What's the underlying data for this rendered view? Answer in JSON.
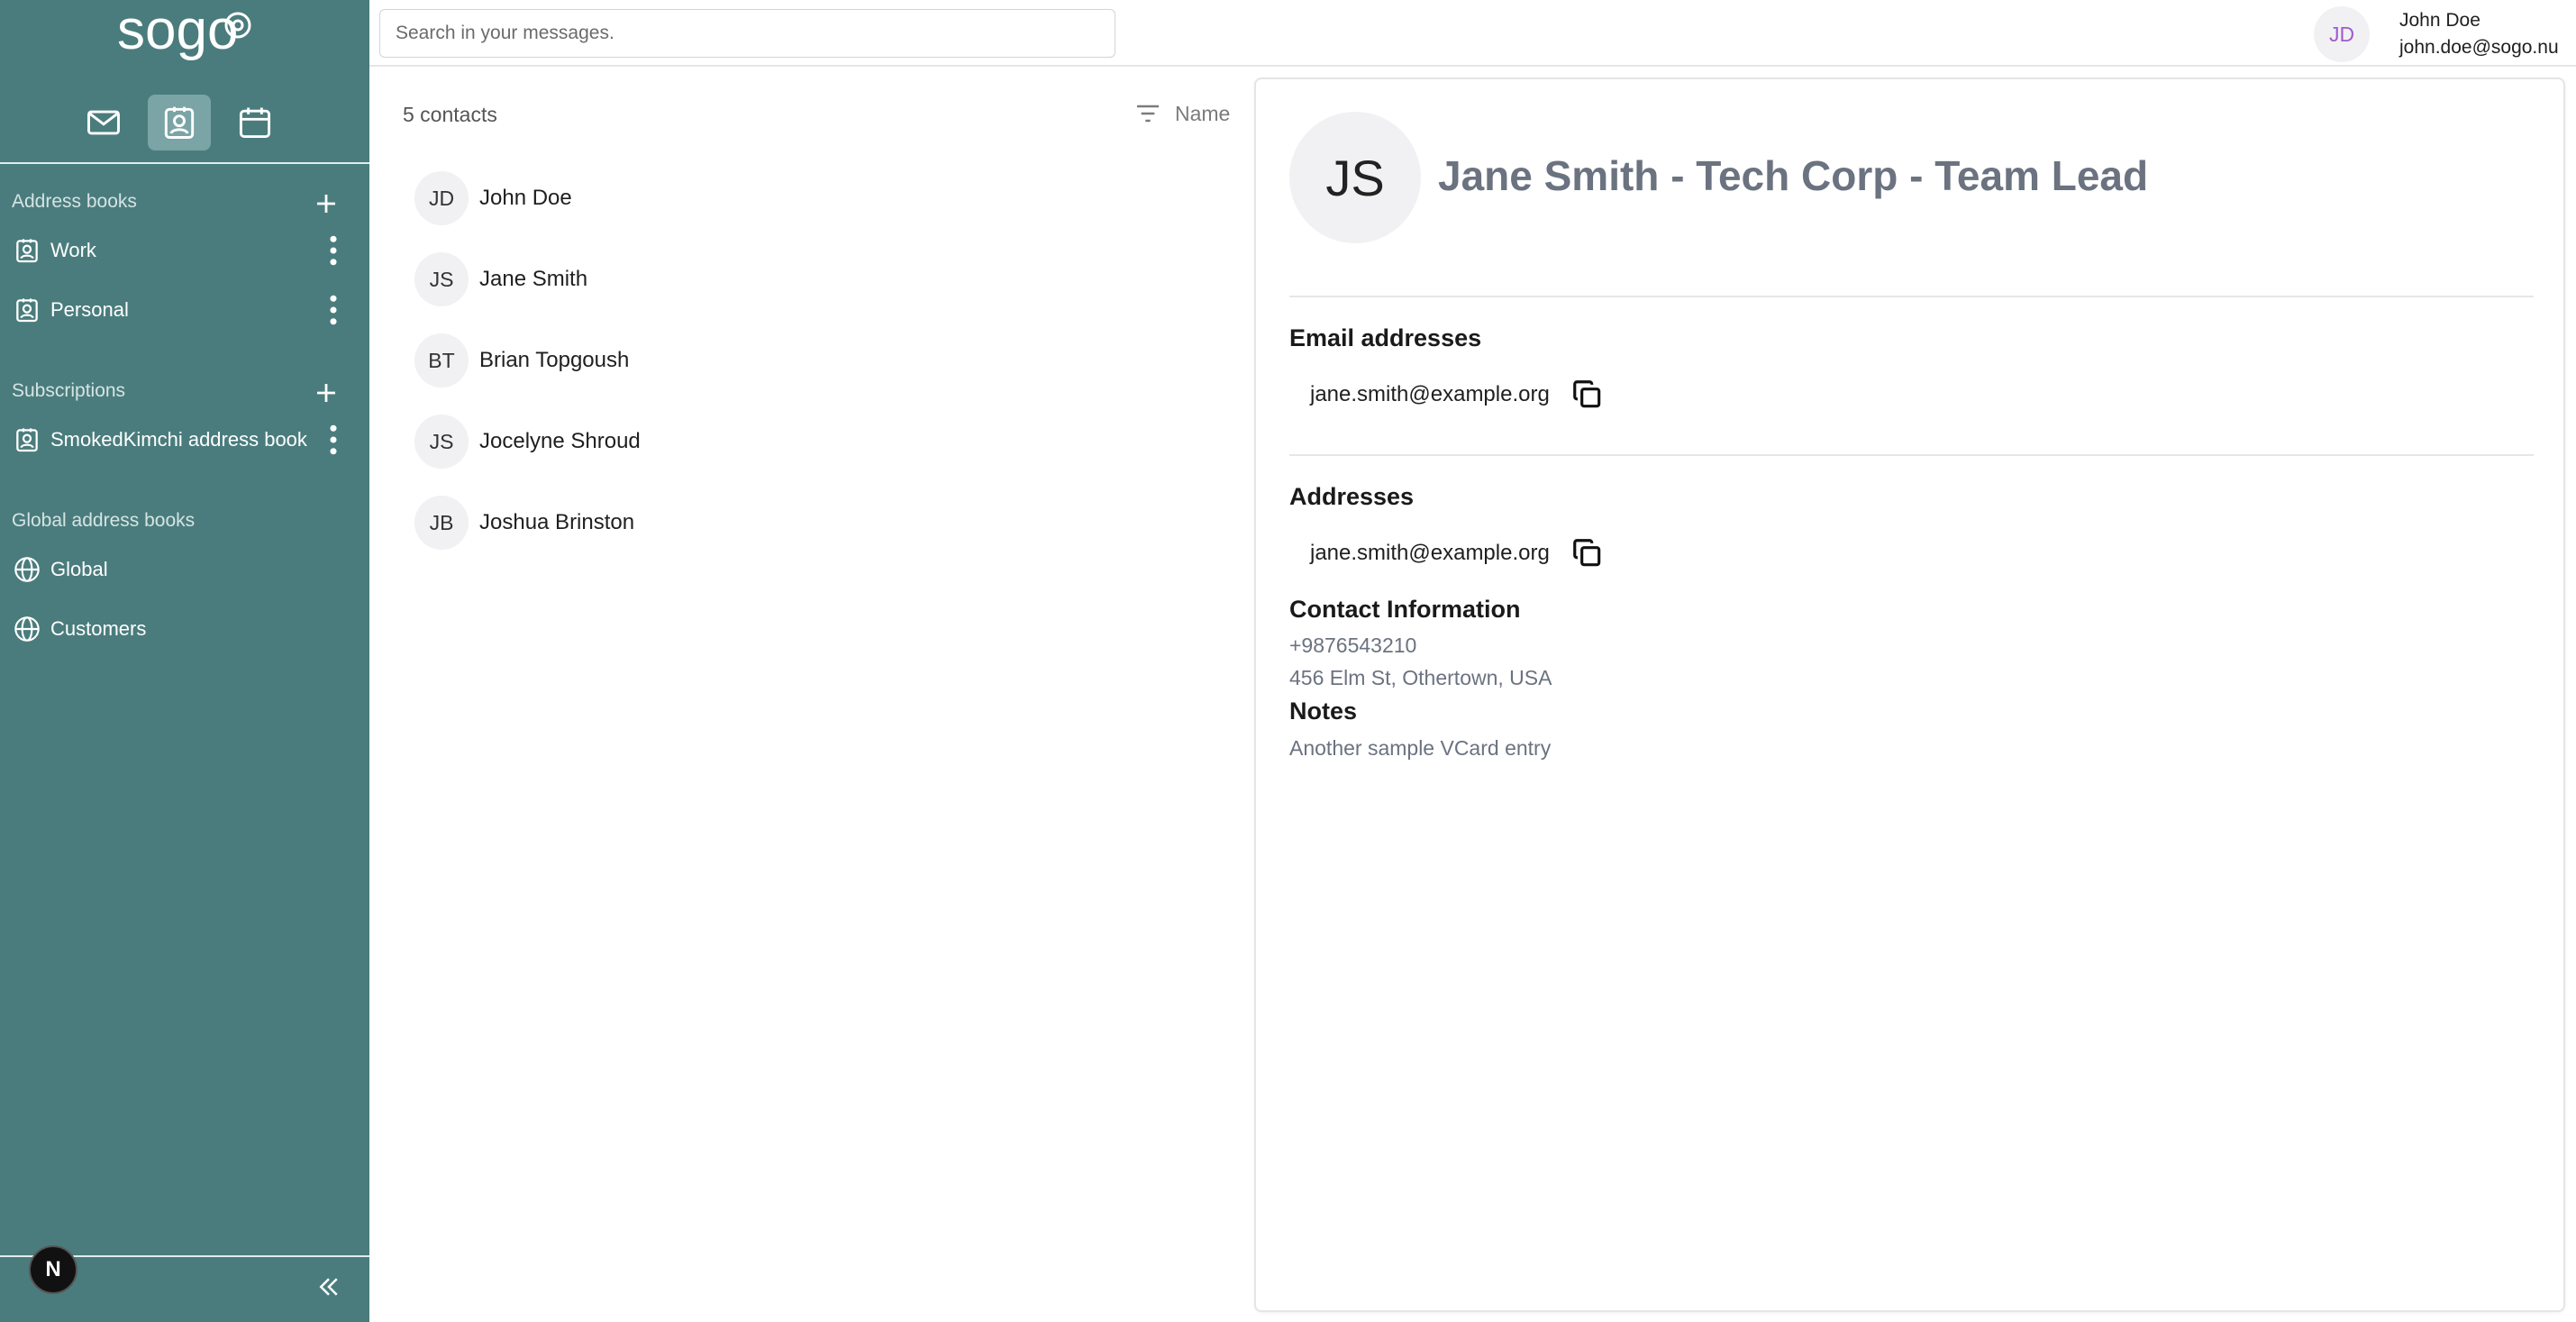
{
  "app": {
    "logo_text": "sogo"
  },
  "sidebar": {
    "address_books_title": "Address books",
    "address_books": [
      {
        "label": "Work"
      },
      {
        "label": "Personal"
      }
    ],
    "subscriptions_title": "Subscriptions",
    "subscriptions": [
      {
        "label": "SmokedKimchi address book"
      }
    ],
    "global_title": "Global address books",
    "global_books": [
      {
        "label": "Global"
      },
      {
        "label": "Customers"
      }
    ],
    "badge_letter": "N"
  },
  "search": {
    "placeholder": "Search in your messages."
  },
  "user": {
    "initials": "JD",
    "name": "John Doe",
    "email": "john.doe@sogo.nu"
  },
  "list": {
    "count_label": "5 contacts",
    "sort_label": "Name",
    "contacts": [
      {
        "initials": "JD",
        "name": "John Doe"
      },
      {
        "initials": "JS",
        "name": "Jane Smith"
      },
      {
        "initials": "BT",
        "name": "Brian Topgoush"
      },
      {
        "initials": "JS",
        "name": "Jocelyne Shroud"
      },
      {
        "initials": "JB",
        "name": "Joshua Brinston"
      }
    ]
  },
  "detail": {
    "initials": "JS",
    "title": "Jane Smith - Tech Corp - Team Lead",
    "email_heading": "Email addresses",
    "email": "jane.smith@example.org",
    "addresses_heading": "Addresses",
    "address_value": "jane.smith@example.org",
    "contact_heading": "Contact Information",
    "phone": "+9876543210",
    "street": "456 Elm St, Othertown, USA",
    "notes_heading": "Notes",
    "notes": "Another sample VCard entry"
  },
  "colors": {
    "sidebar_bg": "#4a7c7d",
    "active_app_bg": "#7aa4a5",
    "avatar_bg": "#f1f1f3",
    "user_initials": "#a05bd0"
  },
  "icons": {
    "mail": "mail-icon",
    "contacts": "contacts-icon",
    "calendar": "calendar-icon",
    "filter": "filter-icon",
    "copy": "copy-icon",
    "globe": "globe-icon",
    "more": "more-vertical-icon",
    "add": "plus-icon",
    "collapse": "double-chevron-left-icon"
  }
}
